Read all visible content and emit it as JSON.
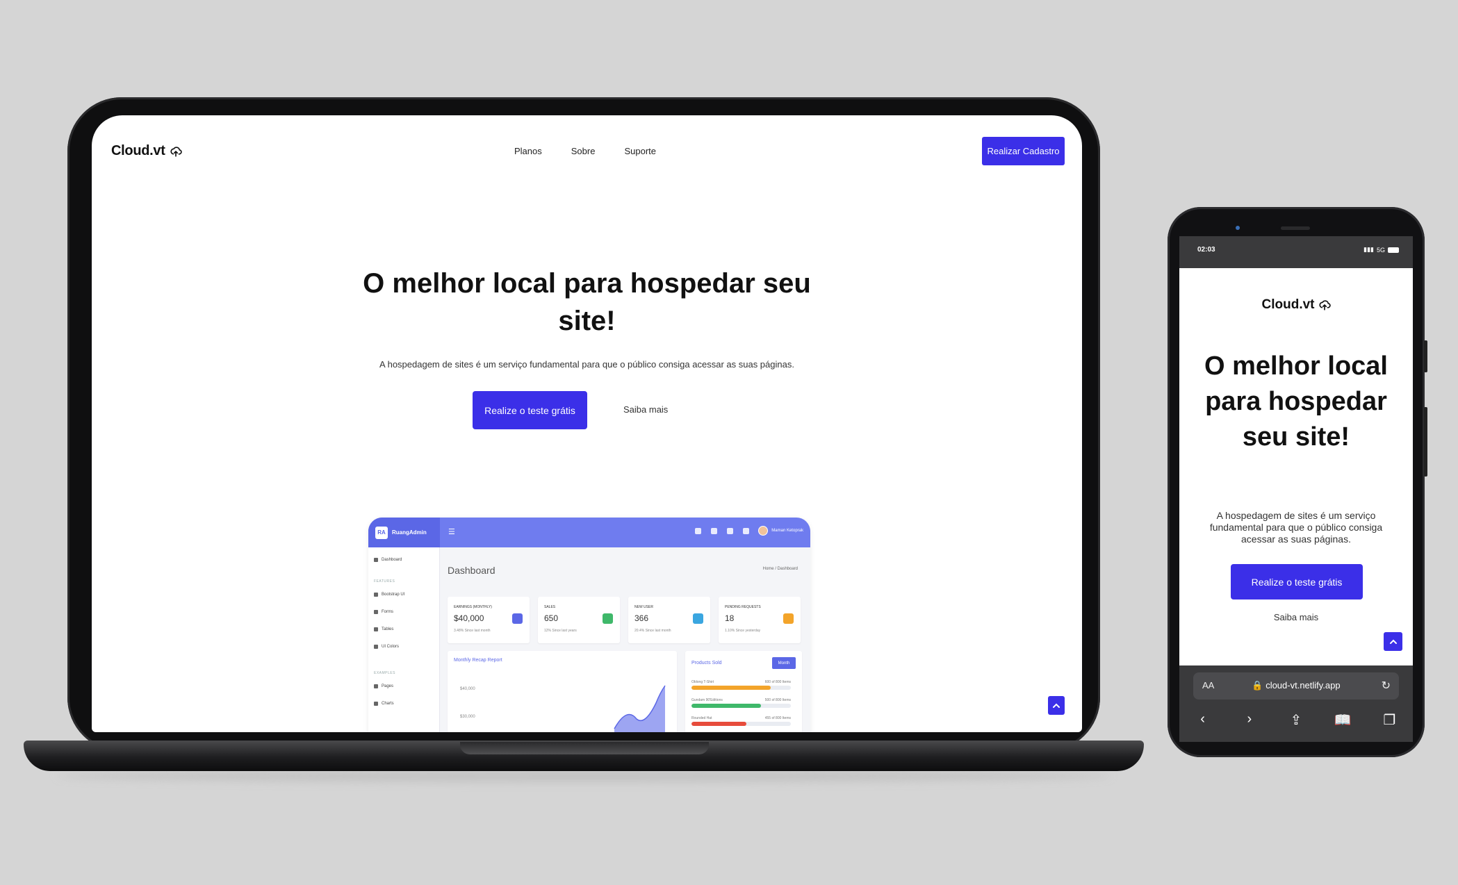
{
  "laptop_site": {
    "logo": "Cloud.vt",
    "nav": [
      "Planos",
      "Sobre",
      "Suporte"
    ],
    "cta_nav": "Realizar Cadastro",
    "hero_title": "O melhor local para hospedar seu site!",
    "hero_sub": "A hospedagem de sites é um serviço fundamental para que o público consiga acessar as suas páginas.",
    "btn_primary": "Realize o teste grátis",
    "btn_link": "Saiba mais"
  },
  "dashboard": {
    "brand_badge": "RA",
    "brand": "RuangAdmin",
    "user": "Maman Ketoprak",
    "title": "Dashboard",
    "crumb": "Home / Dashboard",
    "sidebar": {
      "dashboard": "Dashboard",
      "features_head": "FEATURES",
      "items": [
        "Bootstrap UI",
        "Forms",
        "Tables",
        "UI Colors"
      ],
      "examples_head": "EXAMPLES",
      "examples": [
        "Pages",
        "Charts"
      ]
    },
    "cards": [
      {
        "label": "EARNINGS (MONTHLY)",
        "value": "$40,000",
        "note": "3.48%  Since last month",
        "color": "#5b67e6"
      },
      {
        "label": "SALES",
        "value": "650",
        "note": "12%  Since last years",
        "color": "#3fb86a"
      },
      {
        "label": "NEW USER",
        "value": "366",
        "note": "20.4%  Since last month",
        "color": "#3aa6e0"
      },
      {
        "label": "PENDING REQUESTS",
        "value": "18",
        "note": "1.10%  Since yesterday",
        "color": "#f3a42a"
      }
    ],
    "recap": {
      "title": "Monthly Recap Report",
      "axis": [
        "$40,000",
        "$30,000"
      ]
    },
    "products": {
      "title": "Products Sold",
      "button": "Month",
      "bars": [
        {
          "name": "Oblong T-Shirt",
          "info": "600 of 800 Items",
          "fill": 0.8,
          "color": "#f3a42a"
        },
        {
          "name": "Gundam 90'Editions",
          "info": "500 of 800 Items",
          "fill": 0.7,
          "color": "#3fb86a"
        },
        {
          "name": "Rounded Hat",
          "info": "455 of 800 Items",
          "fill": 0.55,
          "color": "#e74c3c"
        }
      ]
    }
  },
  "phone": {
    "time": "02:03",
    "network": "5G",
    "logo": "Cloud.vt",
    "hero_title": "O melhor local para hospedar seu site!",
    "hero_sub": "A hospedagem de sites é um serviço fundamental para que o público consiga acessar as suas páginas.",
    "btn_primary": "Realize o teste grátis",
    "btn_link": "Saiba mais",
    "browser": {
      "aa": "AA",
      "url": "cloud-vt.netlify.app"
    }
  },
  "colors": {
    "brand": "#3b2fe8",
    "background": "#d5d5d5",
    "device": "#111113"
  }
}
